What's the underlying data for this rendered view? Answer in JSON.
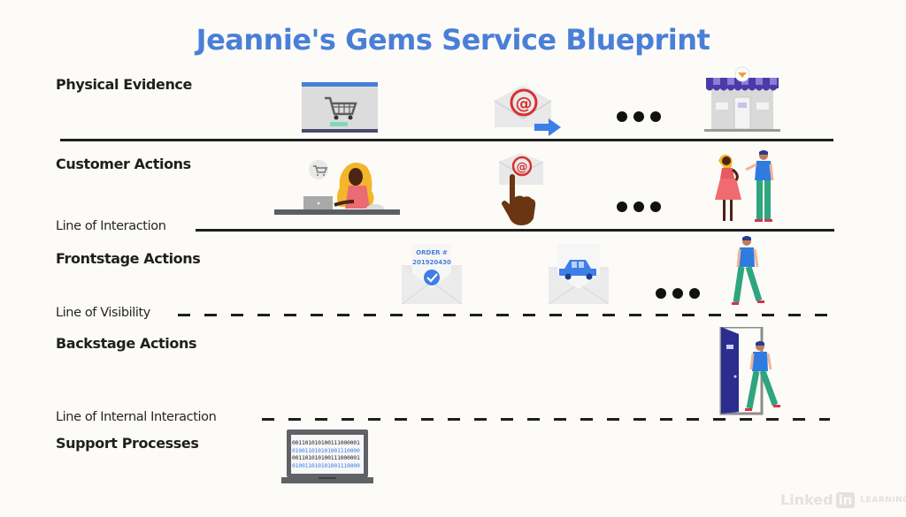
{
  "title": "Jeannie's Gems Service Blueprint",
  "lanes": [
    {
      "label": "Physical Evidence"
    },
    {
      "label": "Customer Actions"
    },
    {
      "label": "Frontstage Actions"
    },
    {
      "label": "Backstage Actions"
    },
    {
      "label": "Support Processes"
    }
  ],
  "lines": [
    {
      "label": "Line of Interaction",
      "style": "solid"
    },
    {
      "label": "Line of Visibility",
      "style": "dashed"
    },
    {
      "label": "Line of Internal Interaction",
      "style": "dashed"
    }
  ],
  "illustrations": {
    "physical_evidence": [
      "shopping-cart-webpage-icon",
      "email-sent-icon",
      "ellipsis",
      "storefront-icon"
    ],
    "customer_actions": [
      "woman-at-laptop-icon",
      "finger-tapping-email-icon",
      "ellipsis",
      "customer-greeting-staff-icon"
    ],
    "frontstage_actions": [
      "order-confirmation-email-icon",
      "delivery-car-email-icon",
      "ellipsis",
      "staff-walking-icon"
    ],
    "backstage_actions": [
      "staff-exiting-door-icon"
    ],
    "support_processes": [
      "binary-data-laptop-icon"
    ]
  },
  "order_email": {
    "heading": "ORDER #",
    "number": "201920430"
  },
  "binary_lines": [
    "001101010100111000001",
    "010011010101001110000",
    "001101010100111000001",
    "010011010101001110000"
  ],
  "watermark": {
    "brand": "Linked",
    "box": "in",
    "suffix": "LEARNING"
  },
  "colors": {
    "title": "#4a7fd8",
    "accent_blue": "#3d7ee8",
    "awning_purple": "#4b3aa8",
    "email_red": "#d9302f",
    "shirt_blue": "#2f7be0",
    "pants_green": "#2fa57f",
    "door_navy": "#2b2e8f"
  }
}
